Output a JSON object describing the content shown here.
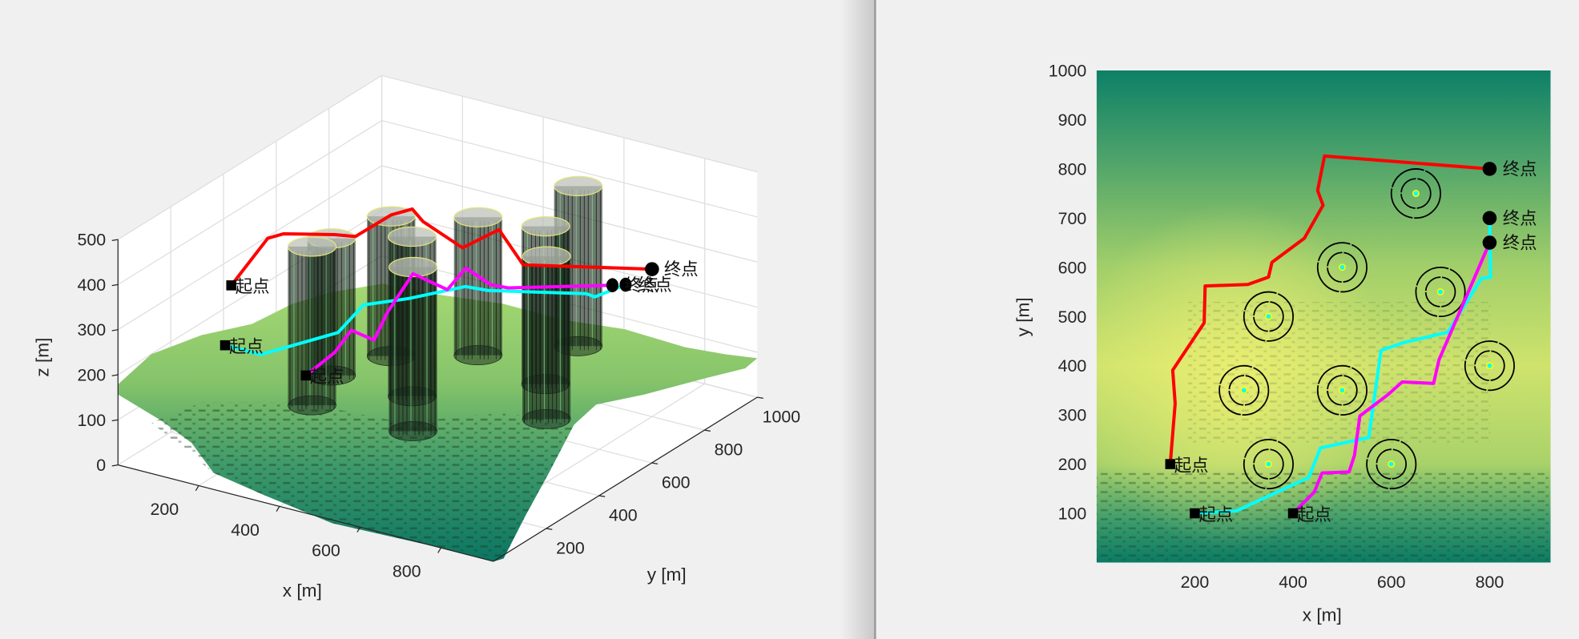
{
  "chart_data": [
    {
      "type": "surface3d",
      "xlabel": "x [m]",
      "ylabel": "y [m]",
      "zlabel": "z [m]",
      "xlim": [
        0,
        930
      ],
      "ylim": [
        0,
        1000
      ],
      "zlim": [
        0,
        500
      ],
      "xticks": [
        200,
        400,
        600,
        800
      ],
      "yticks": [
        200,
        400,
        600,
        800,
        1000
      ],
      "zticks": [
        0,
        100,
        200,
        300,
        400,
        500
      ],
      "grid": true,
      "start_label": "起点",
      "end_label": "终点",
      "series": [
        {
          "color": "#ff0000",
          "x": [
            150,
            160,
            155,
            219,
            221,
            308,
            350,
            357,
            423,
            461,
            450,
            464,
            800
          ],
          "y": [
            200,
            323,
            391,
            487,
            562,
            565,
            580,
            610,
            659,
            726,
            756,
            826,
            800
          ],
          "z": [
            360,
            422,
            406,
            384,
            353,
            420,
            437,
            400,
            339,
            360,
            350,
            250,
            327
          ]
        },
        {
          "color": "#00ffff",
          "x": [
            200,
            285,
            432,
            456,
            554,
            579,
            625,
            715,
            783,
            802,
            800
          ],
          "y": [
            100,
            105,
            173,
            233,
            254,
            431,
            447,
            468,
            577,
            580,
            700
          ],
          "z": [
            275,
            272,
            330,
            375,
            404,
            372,
            368,
            378,
            350,
            346,
            329
          ]
        },
        {
          "color": "#ff00ff",
          "x": [
            400,
            443,
            459,
            514,
            525,
            536,
            593,
            622,
            686,
            697,
            800
          ],
          "y": [
            100,
            143,
            182,
            184,
            218,
            298,
            341,
            367,
            364,
            412,
            650
          ],
          "z": [
            254,
            299,
            338,
            328,
            380,
            439,
            401,
            446,
            425,
            403,
            346
          ]
        }
      ],
      "obstacles": [
        {
          "x": 650,
          "y": 750,
          "r": 50,
          "top": 495
        },
        {
          "x": 500,
          "y": 600,
          "r": 50,
          "top": 446
        },
        {
          "x": 700,
          "y": 550,
          "r": 50,
          "top": 490
        },
        {
          "x": 350,
          "y": 500,
          "r": 50,
          "top": 450
        },
        {
          "x": 300,
          "y": 350,
          "r": 50,
          "top": 444
        },
        {
          "x": 500,
          "y": 350,
          "r": 50,
          "top": 494
        },
        {
          "x": 800,
          "y": 400,
          "r": 50,
          "top": 501
        },
        {
          "x": 350,
          "y": 200,
          "r": 50,
          "top": 492
        },
        {
          "x": 600,
          "y": 200,
          "r": 50,
          "top": 504
        }
      ]
    },
    {
      "type": "heatmap",
      "xlabel": "x [m]",
      "ylabel": "y [m]",
      "xlim": [
        0,
        925
      ],
      "ylim": [
        0,
        1000
      ],
      "xticks": [
        200,
        400,
        600,
        800
      ],
      "yticks": [
        100,
        200,
        300,
        400,
        500,
        600,
        700,
        800,
        900,
        1000
      ],
      "start_label": "起点",
      "end_label": "终点",
      "threat_radii": [
        50,
        30,
        6
      ],
      "colormap": [
        "#0b7a63",
        "#5aa86a",
        "#a8d26a",
        "#e3ea6e"
      ]
    }
  ]
}
